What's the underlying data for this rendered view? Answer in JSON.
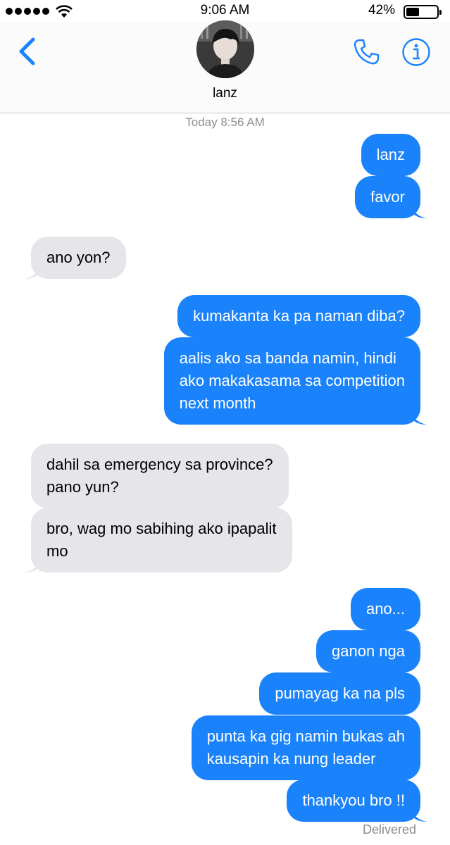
{
  "status_bar": {
    "time": "9:06 AM",
    "battery_percent": "42%",
    "battery_level": 0.42,
    "signal_bars": 5
  },
  "header": {
    "contact_name": "lanz",
    "back_icon": "chevron-left-icon",
    "call_icon": "phone-icon",
    "info_icon": "info-icon"
  },
  "thread": {
    "timestamp": "Today 8:56 AM",
    "messages": [
      {
        "from": "me",
        "text": "lanz"
      },
      {
        "from": "me",
        "text": "favor"
      },
      {
        "from": "them",
        "text": "ano yon?"
      },
      {
        "from": "me",
        "text": "kumakanta ka pa naman diba?"
      },
      {
        "from": "me",
        "lines": [
          "aalis ako sa banda namin, hindi",
          "ako makakasama sa competition",
          "next month"
        ]
      },
      {
        "from": "them",
        "lines": [
          "dahil sa emergency sa province?",
          "pano yun?"
        ]
      },
      {
        "from": "them",
        "lines": [
          "bro, wag mo sabihing ako ipapalit",
          "mo"
        ]
      },
      {
        "from": "me",
        "text": "ano..."
      },
      {
        "from": "me",
        "text": "ganon nga"
      },
      {
        "from": "me",
        "text": "pumayag ka na pls"
      },
      {
        "from": "me",
        "lines": [
          "punta ka gig namin bukas ah",
          "kausapin ka nung leader"
        ]
      },
      {
        "from": "me",
        "text": "thankyou bro !!"
      }
    ],
    "delivery_status": "Delivered"
  },
  "colors": {
    "sent_bubble": "#1a82fb",
    "received_bubble": "#e5e5ea",
    "accent": "#1a82fb",
    "meta_text": "#8e8e93"
  }
}
